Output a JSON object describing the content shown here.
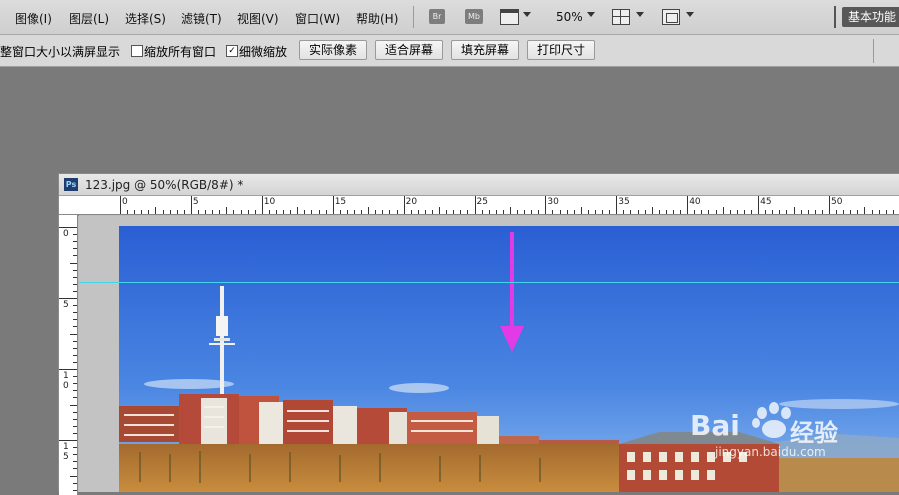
{
  "menu": {
    "items": [
      "图像(I)",
      "图层(L)",
      "选择(S)",
      "滤镜(T)",
      "视图(V)",
      "窗口(W)",
      "帮助(H)"
    ],
    "bridge_label": "Br",
    "minibridge_label": "Mb",
    "zoom": "50%",
    "workspace": "基本功能"
  },
  "options": {
    "resize_windows_label": "整窗口大小以满屏显示",
    "zoom_all_label": "缩放所有窗口",
    "zoom_all_checked": false,
    "scrubby_label": "细微缩放",
    "scrubby_checked": true,
    "buttons": [
      "实际像素",
      "适合屏幕",
      "填充屏幕",
      "打印尺寸"
    ]
  },
  "document": {
    "title": "123.jpg @ 50%(RGB/8#) *",
    "ps_icon": "Ps",
    "ruler_h_labels": [
      "0",
      "5",
      "10",
      "15",
      "20",
      "25",
      "30",
      "35",
      "40",
      "45",
      "50"
    ],
    "ruler_v_labels": [
      "0",
      "5",
      "1\n0",
      "1\n5"
    ]
  },
  "watermark": {
    "brand": "Bai",
    "brand_suffix": "经验",
    "url": "jingyan.baidu.com"
  },
  "colors": {
    "guide": "#42d7e8",
    "arrow": "#e23be6",
    "sky_top": "#2e63d6",
    "sky_bottom": "#5e94e6",
    "building": "#b4472e"
  }
}
